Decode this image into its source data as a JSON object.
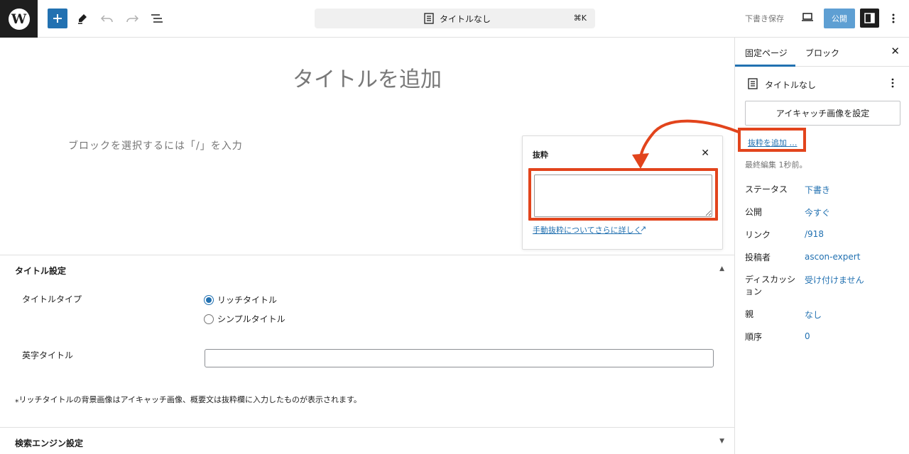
{
  "topbar": {
    "document_title": "タイトルなし",
    "shortcut": "⌘K",
    "save_draft": "下書き保存",
    "publish": "公開"
  },
  "editor": {
    "title_placeholder": "タイトルを追加",
    "block_placeholder": "ブロックを選択するには「/」を入力"
  },
  "excerpt_popover": {
    "title": "抜粋",
    "close": "✕",
    "value": "",
    "link": "手動抜粋についてさらに詳しく",
    "link_icon": "↗"
  },
  "meta_boxes": {
    "title_settings": {
      "header": "タイトル設定",
      "toggle": "▲",
      "title_type_label": "タイトルタイプ",
      "options": [
        "リッチタイトル",
        "シンプルタイトル"
      ],
      "selected": "リッチタイトル",
      "english_title_label": "英字タイトル",
      "english_title_value": "",
      "note": "⁎リッチタイトルの背景画像はアイキャッチ画像、概要文は抜粋欄に入力したものが表示されます。"
    },
    "seo_settings": {
      "header": "検索エンジン設定",
      "toggle": "▼"
    }
  },
  "sidebar": {
    "tabs": [
      "固定ページ",
      "ブロック"
    ],
    "active_tab": "固定ページ",
    "close": "✕",
    "document_title": "タイトルなし",
    "featured_image_button": "アイキャッチ画像を設定",
    "add_excerpt": "抜粋を追加 …",
    "last_edited": "最終編集 1秒前。",
    "rows": [
      {
        "label": "ステータス",
        "value": "下書き"
      },
      {
        "label": "公開",
        "value": "今すぐ"
      },
      {
        "label": "リンク",
        "value": "/918"
      },
      {
        "label": "投稿者",
        "value": "ascon-expert"
      },
      {
        "label": "ディスカッション",
        "value": "受け付けません"
      },
      {
        "label": "親",
        "value": "なし"
      },
      {
        "label": "順序",
        "value": "0"
      }
    ]
  },
  "colors": {
    "accent": "#2271b1",
    "highlight": "#e2441c",
    "publish_bg": "#5e9fd3",
    "logo_bg": "#1e1e1e"
  },
  "icons": [
    "wordpress-logo-icon",
    "plus-icon",
    "pen-icon",
    "undo-icon",
    "redo-icon",
    "list-view-icon",
    "document-icon",
    "preview-device-icon",
    "settings-panel-icon",
    "more-vertical-icon",
    "close-icon",
    "external-link-icon",
    "radio-icon",
    "chevron-up-icon",
    "chevron-down-icon",
    "annotation-arrow-icon"
  ]
}
